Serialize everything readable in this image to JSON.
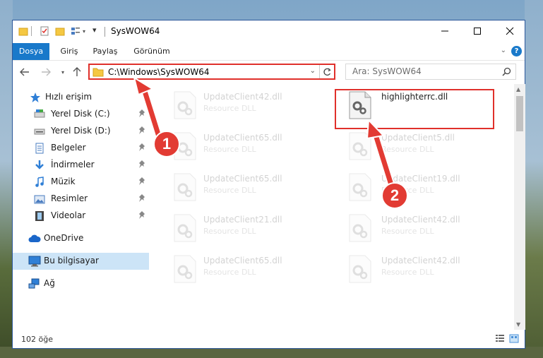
{
  "window": {
    "title": "SysWOW64"
  },
  "ribbon": {
    "tabs": [
      "Dosya",
      "Giriş",
      "Paylaş",
      "Görünüm"
    ],
    "help": "?"
  },
  "address": {
    "path": "C:\\Windows\\SysWOW64"
  },
  "search": {
    "placeholder": "Ara: SysWOW64"
  },
  "sidebar": {
    "items": [
      {
        "label": "Hızlı erişim",
        "icon": "star-icon"
      },
      {
        "label": "Yerel Disk (C:)",
        "icon": "drive-icon"
      },
      {
        "label": "Yerel Disk (D:)",
        "icon": "drive-icon"
      },
      {
        "label": "Belgeler",
        "icon": "documents-icon"
      },
      {
        "label": "İndirmeler",
        "icon": "download-icon"
      },
      {
        "label": "Müzik",
        "icon": "music-icon"
      },
      {
        "label": "Resimler",
        "icon": "pictures-icon"
      },
      {
        "label": "Videolar",
        "icon": "video-icon"
      },
      {
        "label": "OneDrive",
        "icon": "cloud-icon"
      },
      {
        "label": "Bu bilgisayar",
        "icon": "computer-icon"
      },
      {
        "label": "Ağ",
        "icon": "network-icon"
      }
    ]
  },
  "files": [
    {
      "name": "UpdateClient42.dll",
      "type": "Resource DLL"
    },
    {
      "name": "highlighterrc.dll",
      "type": ""
    },
    {
      "name": "UpdateClient65.dll",
      "type": "Resource DLL"
    },
    {
      "name": "UpdateClient5.dll",
      "type": "Resource DLL"
    },
    {
      "name": "UpdateClient65.dll",
      "type": "Resource DLL"
    },
    {
      "name": "UpdateClient19.dll",
      "type": "Resource DLL"
    },
    {
      "name": "UpdateClient21.dll",
      "type": "Resource DLL"
    },
    {
      "name": "UpdateClient42.dll",
      "type": "Resource DLL"
    },
    {
      "name": "UpdateClient65.dll",
      "type": "Resource DLL"
    },
    {
      "name": "UpdateClient42.dll",
      "type": "Resource DLL"
    }
  ],
  "status": {
    "count": "102 öğe"
  },
  "annotations": {
    "badge1": "1",
    "badge2": "2"
  },
  "colors": {
    "accent": "#1979ca",
    "highlight": "#e0302b"
  }
}
